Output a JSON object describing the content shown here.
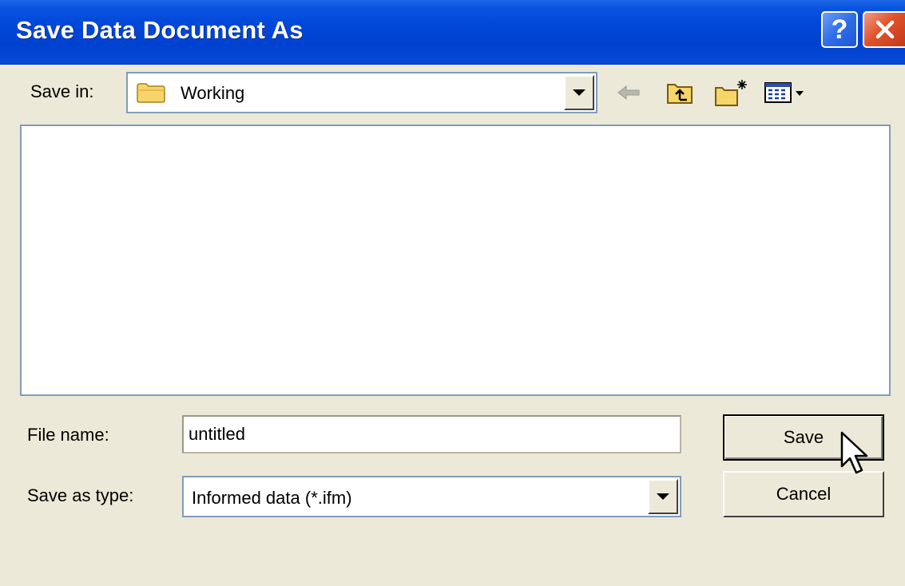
{
  "window": {
    "title": "Save Data Document As",
    "help_glyph": "?",
    "close_glyph": "✕"
  },
  "save_in": {
    "label": "Save in:",
    "value": "Working",
    "icon": "folder-icon"
  },
  "toolbar": {
    "icons": [
      "back-arrow-icon",
      "up-one-level-icon",
      "create-new-folder-icon",
      "view-menu-icon"
    ]
  },
  "file_name": {
    "label": "File name:",
    "value": "untitled"
  },
  "save_as_type": {
    "label": "Save as type:",
    "value": "Informed data (*.ifm)"
  },
  "buttons": {
    "save": "Save",
    "cancel": "Cancel"
  },
  "colors": {
    "titlebar": "#0046d8",
    "dialog_bg": "#ece9d8",
    "close_red": "#e0532c",
    "help_blue": "#2f6ee8"
  }
}
